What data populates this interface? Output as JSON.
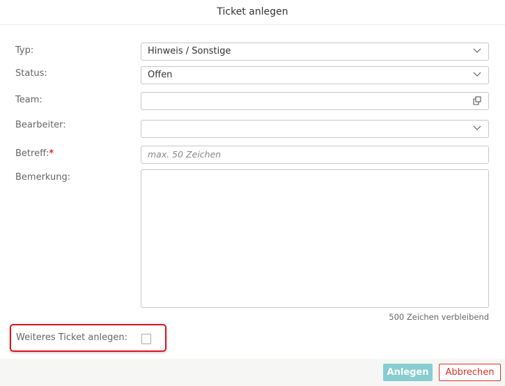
{
  "dialog": {
    "title": "Ticket anlegen"
  },
  "form": {
    "typ": {
      "label": "Typ:",
      "value": "Hinweis / Sonstige"
    },
    "status": {
      "label": "Status:",
      "value": "Offen"
    },
    "team": {
      "label": "Team:",
      "value": ""
    },
    "bearbeiter": {
      "label": "Bearbeiter:",
      "value": ""
    },
    "betreff": {
      "label": "Betreff:",
      "required_mark": "*",
      "value": "",
      "placeholder": "max. 50 Zeichen"
    },
    "bemerkung": {
      "label": "Bemerkung:",
      "value": "",
      "counter": "500 Zeichen verbleibend"
    },
    "weiteres": {
      "label": "Weiteres Ticket anlegen:",
      "checked": false
    }
  },
  "footer": {
    "submit_label": "Anlegen",
    "cancel_label": "Abbrechen"
  },
  "colors": {
    "submit": "#88cdd0",
    "cancel": "#d9312c",
    "highlight": "#e0141e"
  }
}
